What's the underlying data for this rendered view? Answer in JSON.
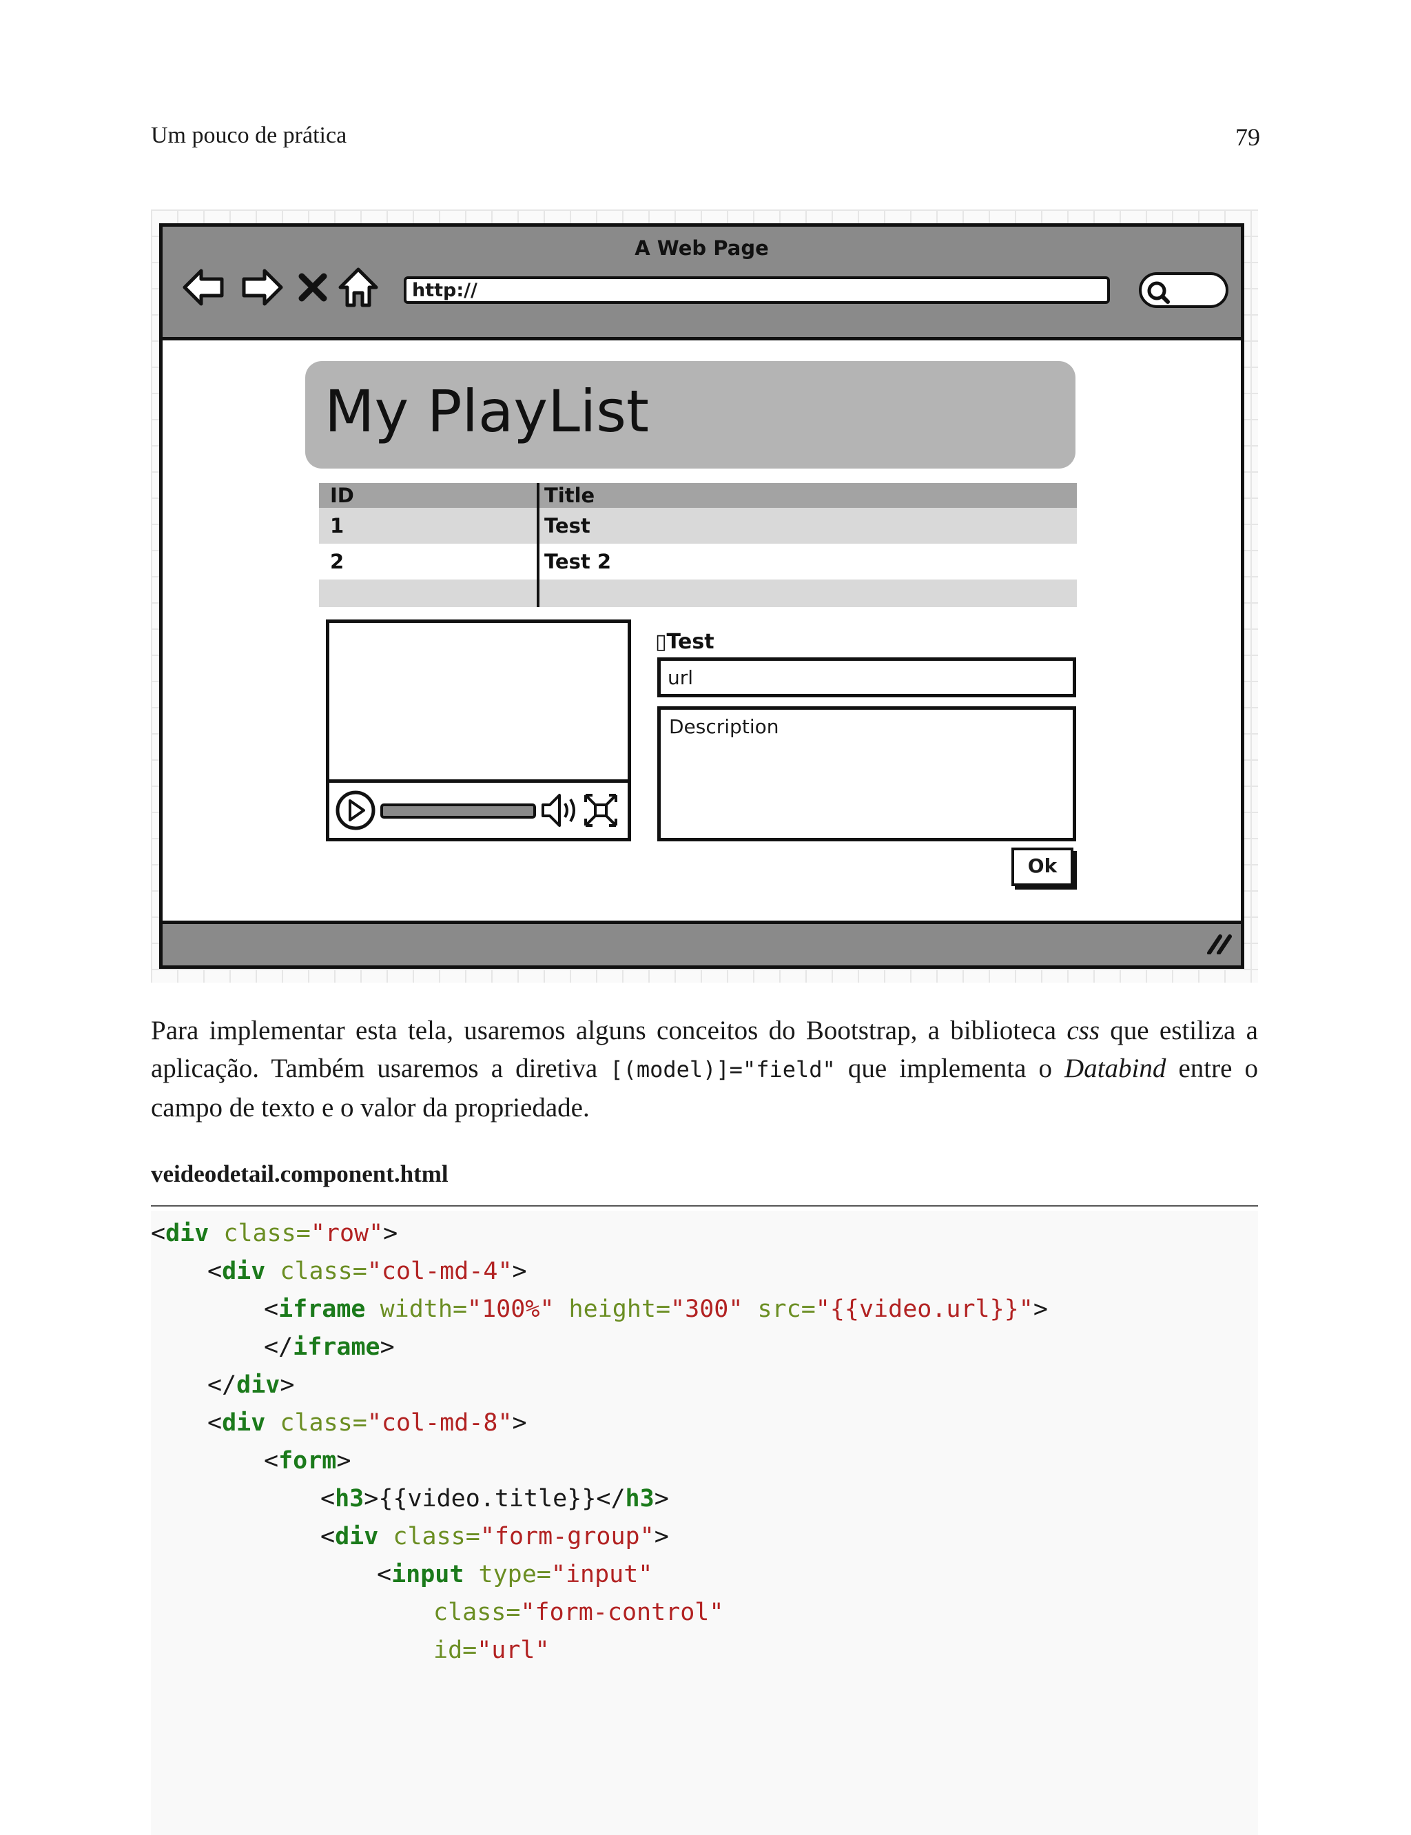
{
  "page": {
    "running_head": "Um pouco de prática",
    "page_number": "79"
  },
  "mockup": {
    "window_title": "A Web Page",
    "url": "http://",
    "heading": "My PlayList",
    "grid": {
      "columns": [
        "ID",
        "Title"
      ],
      "rows": [
        [
          "1",
          "Test"
        ],
        [
          "2",
          "Test 2"
        ]
      ]
    },
    "video_title": "▯Test",
    "url_field": "url",
    "description_field": "Description",
    "ok_button": "Ok",
    "icons": [
      "back-arrow-icon",
      "forward-arrow-icon",
      "close-x-icon",
      "home-icon",
      "search-icon",
      "play-icon",
      "volume-icon",
      "fullscreen-icon",
      "resize-grip-icon"
    ]
  },
  "paragraph": {
    "t1": "Para implementar esta tela, usaremos alguns conceitos do Bootstrap, a biblioteca ",
    "css": "css",
    "t2": " que estiliza a aplicação. Também usaremos a diretiva ",
    "code": "[(model)]=\"field\"",
    "t3": " que implementa o ",
    "databind": "Databind",
    "t4": " entre o campo de texto e o valor da propriedade."
  },
  "code_caption": "veideodetail.component.html",
  "code": {
    "l1": {
      "lt": "<",
      "tag": "div",
      "a1": " class=",
      "v1": "\"row\"",
      "gt": ">"
    },
    "l2": {
      "lt": "<",
      "tag": "div",
      "a1": " class=",
      "v1": "\"col-md-4\"",
      "gt": ">"
    },
    "l3": {
      "lt": "<",
      "tag": "iframe",
      "a1": " width=",
      "v1": "\"100%\"",
      "a2": " height=",
      "v2": "\"300\"",
      "a3": " src=",
      "v3": "\"{{video.url}}\"",
      "gt": ">"
    },
    "l4": {
      "lt": "</",
      "tag": "iframe",
      "gt": ">"
    },
    "l5": {
      "lt": "</",
      "tag": "div",
      "gt": ">"
    },
    "l6": {
      "lt": "<",
      "tag": "div",
      "a1": " class=",
      "v1": "\"col-md-8\"",
      "gt": ">"
    },
    "l7": {
      "lt": "<",
      "tag": "form",
      "gt": ">"
    },
    "l8": {
      "lt": "<",
      "tag": "h3",
      "gt": ">",
      "text": "{{video.title}}",
      "lt2": "</",
      "tag2": "h3",
      "gt2": ">"
    },
    "l9": {
      "lt": "<",
      "tag": "div",
      "a1": " class=",
      "v1": "\"form-group\"",
      "gt": ">"
    },
    "l10": {
      "lt": "<",
      "tag": "input",
      "a1": " type=",
      "v1": "\"input\""
    },
    "l11": {
      "a1": "class=",
      "v1": "\"form-control\""
    },
    "l12": {
      "a1": "id=",
      "v1": "\"url\""
    }
  }
}
